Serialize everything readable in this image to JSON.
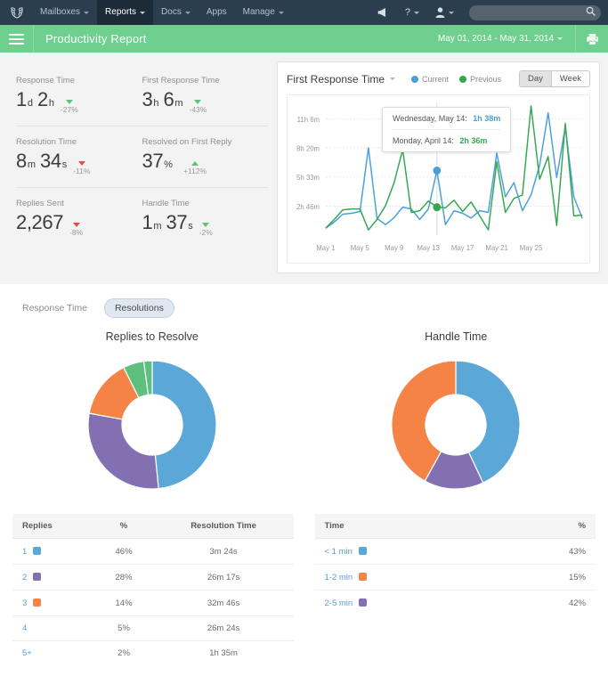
{
  "topnav": {
    "logo_icon": "laurel-wreath-logo",
    "items": [
      {
        "label": "Mailboxes",
        "caret": true,
        "active": false
      },
      {
        "label": "Reports",
        "caret": true,
        "active": true
      },
      {
        "label": "Docs",
        "caret": true,
        "active": false
      },
      {
        "label": "Apps",
        "caret": false,
        "active": false
      },
      {
        "label": "Manage",
        "caret": true,
        "active": false
      }
    ],
    "announce_icon": "megaphone-icon",
    "help_label": "?",
    "user_icon": "person-icon",
    "search_placeholder": ""
  },
  "header": {
    "menu_icon": "hamburger-menu-icon",
    "title": "Productivity Report",
    "date_range": "May 01, 2014 - May 31, 2014",
    "print_icon": "printer-icon",
    "bar_color": "#6ecf8e"
  },
  "stats": [
    {
      "label": "Response Time",
      "num1": "1",
      "unit1": "d",
      "num2": "2",
      "unit2": "h",
      "delta": "-27%",
      "dir": "down",
      "good": true
    },
    {
      "label": "First Response Time",
      "num1": "3",
      "unit1": "h",
      "num2": "6",
      "unit2": "m",
      "delta": "-43%",
      "dir": "down",
      "good": true
    },
    {
      "label": "Resolution Time",
      "num1": "8",
      "unit1": "m",
      "num2": "34",
      "unit2": "s",
      "delta": "-11%",
      "dir": "down",
      "good": false
    },
    {
      "label": "Resolved on First Reply",
      "num1": "37",
      "unit1": "%",
      "num2": "",
      "unit2": "",
      "delta": "+112%",
      "dir": "up",
      "good": true
    },
    {
      "label": "Replies Sent",
      "num1": "2,267",
      "unit1": "",
      "num2": "",
      "unit2": "",
      "delta": "-8%",
      "dir": "down",
      "good": false
    },
    {
      "label": "Handle Time",
      "num1": "1",
      "unit1": "m",
      "num2": "37",
      "unit2": "s",
      "delta": "-2%",
      "dir": "down",
      "good": true
    }
  ],
  "chart_panel": {
    "title": "First Response Time",
    "legend": [
      {
        "label": "Current",
        "color": "#4a9fd8"
      },
      {
        "label": "Previous",
        "color": "#33a852"
      }
    ],
    "toggle": [
      {
        "label": "Day",
        "selected": true
      },
      {
        "label": "Week",
        "selected": false
      }
    ],
    "tooltip": [
      {
        "date": "Wednesday, May 14:",
        "value": "1h 38m",
        "color": "#4a9fd8"
      },
      {
        "date": "Monday, April 14:",
        "value": "2h 36m",
        "color": "#33a852"
      }
    ]
  },
  "tabs": [
    {
      "label": "Response Time",
      "active": false
    },
    {
      "label": "Resolutions",
      "active": true
    }
  ],
  "chart_data": [
    {
      "type": "line",
      "title": "First Response Time",
      "xlabel": "",
      "ylabel": "",
      "grid": true,
      "legend_position": "top",
      "ytick_labels": [
        "2h 46m",
        "5h 33m",
        "8h 20m",
        "11h 6m"
      ],
      "ytick_values": [
        166,
        333,
        500,
        666
      ],
      "ylim": [
        0,
        760
      ],
      "xtick_labels": [
        "May 1",
        "May 5",
        "May 9",
        "May 13",
        "May 17",
        "May 21",
        "May 25"
      ],
      "x": [
        1,
        2,
        3,
        4,
        5,
        6,
        7,
        8,
        9,
        10,
        11,
        12,
        13,
        14,
        15,
        16,
        17,
        18,
        19,
        20,
        21,
        22,
        23,
        24,
        25,
        26,
        27,
        28,
        29,
        30,
        31
      ],
      "series": [
        {
          "name": "Current",
          "color": "#4a9fd8",
          "values": [
            40,
            75,
            120,
            125,
            135,
            500,
            95,
            60,
            100,
            160,
            150,
            90,
            150,
            370,
            60,
            140,
            125,
            98,
            140,
            130,
            470,
            220,
            300,
            140,
            230,
            400,
            700,
            330,
            620,
            220,
            95
          ]
        },
        {
          "name": "Previous",
          "color": "#33a852",
          "values": [
            40,
            90,
            145,
            150,
            150,
            30,
            90,
            170,
            300,
            490,
            130,
            140,
            195,
            160,
            156,
            200,
            135,
            190,
            110,
            30,
            420,
            130,
            210,
            230,
            740,
            320,
            450,
            55,
            640,
            110,
            115
          ]
        }
      ],
      "markers": [
        {
          "series": "Previous",
          "x": 14,
          "label": "Monday, April 14: 2h 36m"
        },
        {
          "series": "Current",
          "x": 14,
          "label": "Wednesday, May 14: 1h 38m"
        }
      ]
    },
    {
      "type": "pie",
      "variant": "donut",
      "title": "Replies to Resolve",
      "labels": [
        "1",
        "2",
        "3",
        "4",
        "5+"
      ],
      "values": [
        46,
        28,
        14,
        5,
        2
      ],
      "colors": [
        "#5ba7d8",
        "#8370b3",
        "#f58345",
        "#5fbf7f",
        "#5fbf7f"
      ],
      "start_angle": -90
    },
    {
      "type": "pie",
      "variant": "donut",
      "title": "Handle Time",
      "labels": [
        "< 1 min",
        "2-5 min",
        "1-2 min"
      ],
      "values": [
        43,
        15,
        42
      ],
      "colors": [
        "#5ba7d8",
        "#8370b3",
        "#f58345"
      ],
      "start_angle": -90
    }
  ],
  "donuts": [
    {
      "title": "Replies to Resolve"
    },
    {
      "title": "Handle Time"
    }
  ],
  "table_replies": {
    "columns": [
      "Replies",
      "%",
      "Resolution Time"
    ],
    "rows": [
      {
        "key": "1",
        "color": "#5ba7d8",
        "pct": "46%",
        "time": "3m 24s"
      },
      {
        "key": "2",
        "color": "#8370b3",
        "pct": "28%",
        "time": "26m 17s"
      },
      {
        "key": "3",
        "color": "#f58345",
        "pct": "14%",
        "time": "32m 46s"
      },
      {
        "key": "4",
        "color": "",
        "pct": "5%",
        "time": "26m 24s"
      },
      {
        "key": "5+",
        "color": "",
        "pct": "2%",
        "time": "1h 35m"
      }
    ]
  },
  "table_time": {
    "columns": [
      "Time",
      "%"
    ],
    "rows": [
      {
        "key": "< 1 min",
        "color": "#5ba7d8",
        "pct": "43%"
      },
      {
        "key": "1-2 min",
        "color": "#f58345",
        "pct": "15%"
      },
      {
        "key": "2-5 min",
        "color": "#8370b3",
        "pct": "42%"
      }
    ]
  }
}
